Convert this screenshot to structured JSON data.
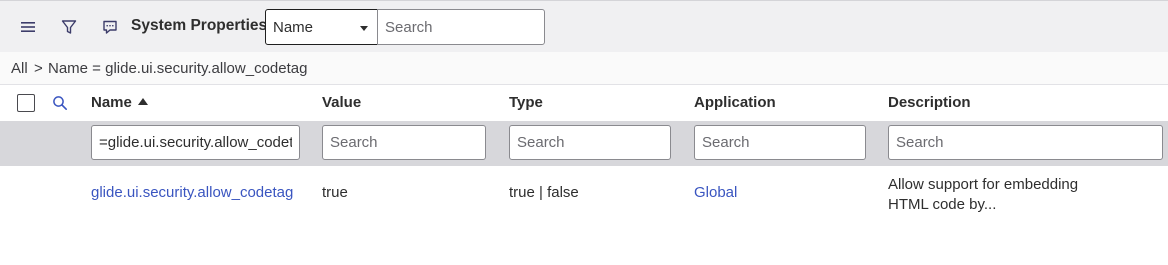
{
  "header": {
    "menu_icon": "hamburger-menu-icon",
    "filter_icon": "funnel-filter-icon",
    "comment_icon": "chat-bubble-icon",
    "title": "System Properties",
    "search_field": {
      "selected": "Name"
    },
    "search": {
      "value": "",
      "placeholder": "Search"
    }
  },
  "breadcrumb": {
    "all": "All",
    "separator": ">",
    "condition": "Name = glide.ui.security.allow_codetag"
  },
  "columns": {
    "name": "Name",
    "value": "Value",
    "type": "Type",
    "application": "Application",
    "description": "Description",
    "sort_direction": "ascending"
  },
  "column_filters": {
    "name": {
      "value": "=glide.ui.security.allow_codetag",
      "placeholder": "Search"
    },
    "value": {
      "value": "",
      "placeholder": "Search"
    },
    "type": {
      "value": "",
      "placeholder": "Search"
    },
    "application": {
      "value": "",
      "placeholder": "Search"
    },
    "description": {
      "value": "",
      "placeholder": "Search"
    }
  },
  "rows": [
    {
      "name": "glide.ui.security.allow_codetag",
      "value": "true",
      "type": "true | false",
      "application": "Global",
      "description": "Allow support for embedding HTML code by..."
    }
  ],
  "colors": {
    "toolbar_bg": "#f0f0f2",
    "filter_row_bg": "#d7d7db",
    "link": "#3a55c0"
  }
}
